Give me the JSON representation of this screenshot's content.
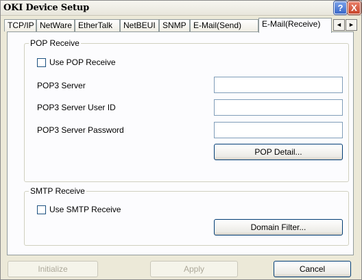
{
  "window": {
    "title": "OKI Device Setup",
    "help_glyph": "?",
    "close_glyph": "X"
  },
  "tabs": [
    {
      "label": "TCP/IP"
    },
    {
      "label": "NetWare"
    },
    {
      "label": "EtherTalk"
    },
    {
      "label": "NetBEUI"
    },
    {
      "label": "SNMP"
    },
    {
      "label": "E-Mail(Send)"
    },
    {
      "label": "E-Mail(Receive)"
    }
  ],
  "tab_scroll": {
    "left": "◄",
    "right": "►"
  },
  "pop": {
    "group_label": "POP Receive",
    "use_label": "Use POP Receive",
    "use_checked": false,
    "server_label": "POP3 Server",
    "server_value": "",
    "userid_label": "POP3 Server User ID",
    "userid_value": "",
    "password_label": "POP3 Server Password",
    "password_value": "",
    "detail_button": "POP Detail..."
  },
  "smtp": {
    "group_label": "SMTP Receive",
    "use_label": "Use SMTP Receive",
    "use_checked": false,
    "domain_button": "Domain Filter..."
  },
  "footer": {
    "initialize": "Initialize",
    "apply": "Apply",
    "cancel": "Cancel"
  }
}
